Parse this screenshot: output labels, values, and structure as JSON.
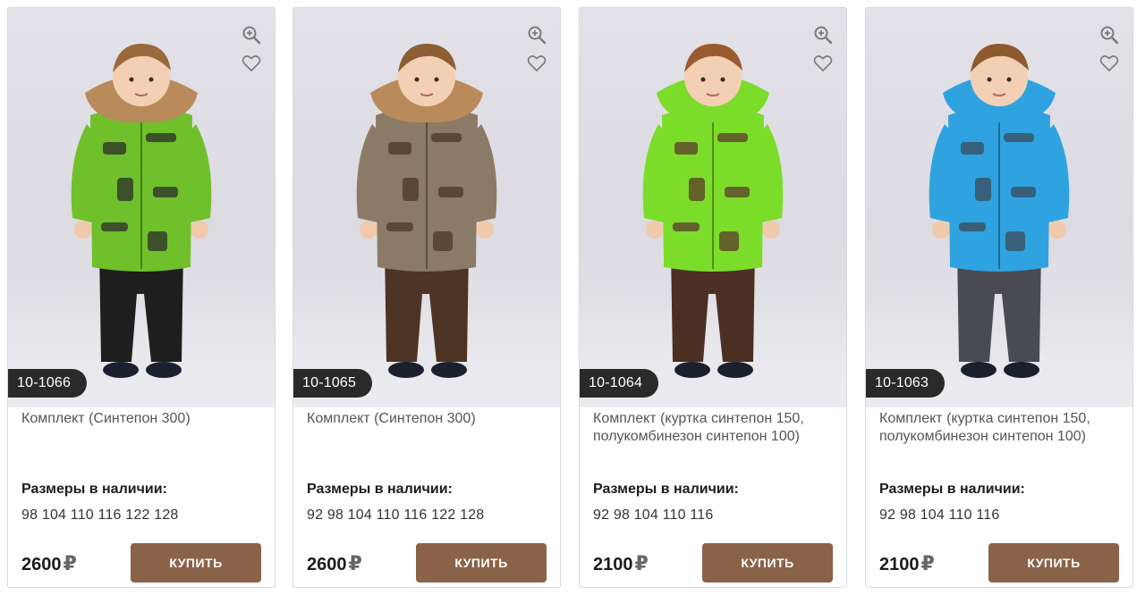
{
  "products": [
    {
      "sku": "10-1066",
      "title": "Комплект (Синтепон 300)",
      "sizes_label": "Размеры в наличии:",
      "sizes": "98 104 110 116 122 128",
      "price": "2600",
      "currency": "₽",
      "buy_label": "КУПИТЬ",
      "colors": {
        "jacket": "#6fc02a",
        "jacket_pattern": "#2b2b2b",
        "pants": "#1e1e1e",
        "collar": "#b98a5a",
        "hair": "#9a6a3c"
      }
    },
    {
      "sku": "10-1065",
      "title": "Комплект (Синтепон 300)",
      "sizes_label": "Размеры в наличии:",
      "sizes": "92 98 104 110 116 122 128",
      "price": "2600",
      "currency": "₽",
      "buy_label": "КУПИТЬ",
      "colors": {
        "jacket": "#8b7a66",
        "jacket_pattern": "#4a3627",
        "pants": "#4e3424",
        "collar": "#b98a5a",
        "hair": "#8d5e33"
      }
    },
    {
      "sku": "10-1064",
      "title": "Комплект (куртка синтепон 150, полукомбинезон синтепон 100)",
      "sizes_label": "Размеры в наличии:",
      "sizes": "92 98 104 110 116",
      "price": "2100",
      "currency": "₽",
      "buy_label": "КУПИТЬ",
      "colors": {
        "jacket": "#7cdc2a",
        "jacket_pattern": "#5a3a2a",
        "pants": "#4a2f22",
        "collar": "#7cdc2a",
        "hair": "#9a5a30"
      }
    },
    {
      "sku": "10-1063",
      "title": "Комплект (куртка синтепон 150, полукомбинезон синтепон 100)",
      "sizes_label": "Размеры в наличии:",
      "sizes": "92 98 104 110 116",
      "price": "2100",
      "currency": "₽",
      "buy_label": "КУПИТЬ",
      "colors": {
        "jacket": "#2fa3e0",
        "jacket_pattern": "#3b4a58",
        "pants": "#4a4a52",
        "collar": "#2fa3e0",
        "hair": "#8d5a30"
      }
    }
  ],
  "icons": {
    "zoom": "zoom-in-icon",
    "favorite": "heart-icon"
  },
  "accent": {
    "button": "#8a6248",
    "badge": "#2a2a2a"
  }
}
